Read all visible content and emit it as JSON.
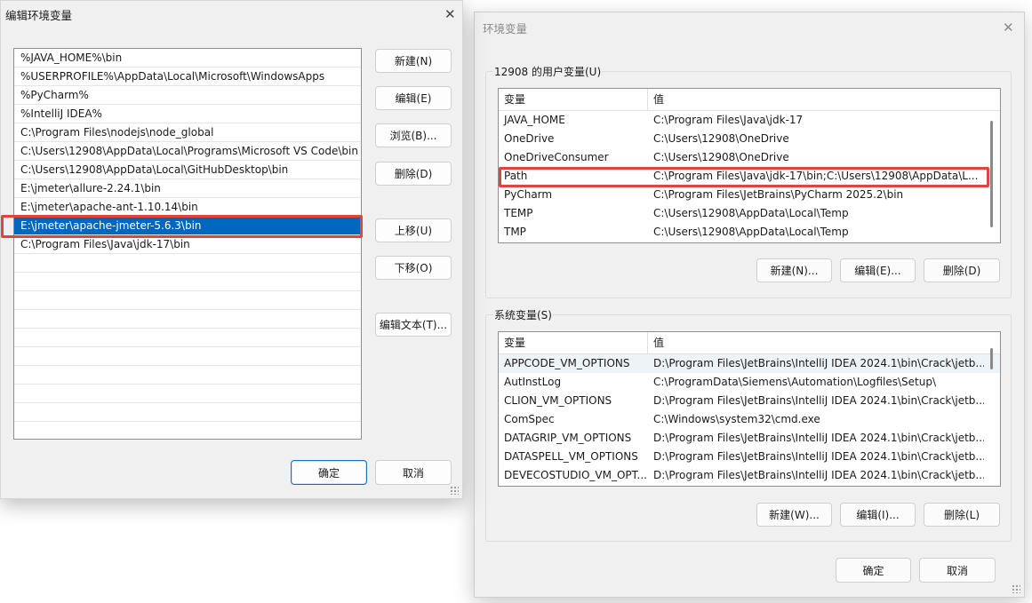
{
  "edit_dialog": {
    "title": "编辑环境变量",
    "paths": [
      "%JAVA_HOME%\\bin",
      "%USERPROFILE%\\AppData\\Local\\Microsoft\\WindowsApps",
      "%PyCharm%",
      "%IntelliJ IDEA%",
      "C:\\Program Files\\nodejs\\node_global",
      "C:\\Users\\12908\\AppData\\Local\\Programs\\Microsoft VS Code\\bin",
      "C:\\Users\\12908\\AppData\\Local\\GitHubDesktop\\bin",
      "E:\\jmeter\\allure-2.24.1\\bin",
      "E:\\jmeter\\apache-ant-1.10.14\\bin",
      "E:\\jmeter\\apache-jmeter-5.6.3\\bin",
      "C:\\Program Files\\Java\\jdk-17\\bin",
      "",
      "",
      "",
      "",
      "",
      "",
      "",
      "",
      "",
      ""
    ],
    "selected_index": 9,
    "buttons": {
      "new": "新建(N)",
      "edit": "编辑(E)",
      "browse": "浏览(B)...",
      "delete": "删除(D)",
      "move_up": "上移(U)",
      "move_down": "下移(O)",
      "edit_text": "编辑文本(T)...",
      "ok": "确定",
      "cancel": "取消"
    }
  },
  "env_dialog": {
    "title": "环境变量",
    "user_group": {
      "label": "12908 的用户变量(U)",
      "col_name": "变量",
      "col_value": "值",
      "rows": [
        {
          "name": "JAVA_HOME",
          "value": "C:\\Program Files\\Java\\jdk-17"
        },
        {
          "name": "OneDrive",
          "value": "C:\\Users\\12908\\OneDrive"
        },
        {
          "name": "OneDriveConsumer",
          "value": "C:\\Users\\12908\\OneDrive"
        },
        {
          "name": "Path",
          "value": "C:\\Program Files\\Java\\jdk-17\\bin;C:\\Users\\12908\\AppData\\L..."
        },
        {
          "name": "PyCharm",
          "value": "C:\\Program Files\\JetBrains\\PyCharm 2025.2\\bin"
        },
        {
          "name": "TEMP",
          "value": "C:\\Users\\12908\\AppData\\Local\\Temp"
        },
        {
          "name": "TMP",
          "value": "C:\\Users\\12908\\AppData\\Local\\Temp"
        }
      ],
      "buttons": {
        "new": "新建(N)...",
        "edit": "编辑(E)...",
        "delete": "删除(D)"
      }
    },
    "system_group": {
      "label": "系统变量(S)",
      "col_name": "变量",
      "col_value": "值",
      "rows": [
        {
          "name": "APPCODE_VM_OPTIONS",
          "value": "D:\\Program Files\\JetBrains\\IntelliJ IDEA 2024.1\\bin\\Crack\\jetb..."
        },
        {
          "name": "AutInstLog",
          "value": "C:\\ProgramData\\Siemens\\Automation\\Logfiles\\Setup\\"
        },
        {
          "name": "CLION_VM_OPTIONS",
          "value": "D:\\Program Files\\JetBrains\\IntelliJ IDEA 2024.1\\bin\\Crack\\jetb..."
        },
        {
          "name": "ComSpec",
          "value": "C:\\Windows\\system32\\cmd.exe"
        },
        {
          "name": "DATAGRIP_VM_OPTIONS",
          "value": "D:\\Program Files\\JetBrains\\IntelliJ IDEA 2024.1\\bin\\Crack\\jetb..."
        },
        {
          "name": "DATASPELL_VM_OPTIONS",
          "value": "D:\\Program Files\\JetBrains\\IntelliJ IDEA 2024.1\\bin\\Crack\\jetb..."
        },
        {
          "name": "DEVECOSTUDIO_VM_OPT...",
          "value": "D:\\Program Files\\JetBrains\\IntelliJ IDEA 2024.1\\bin\\Crack\\jetb..."
        }
      ],
      "buttons": {
        "new": "新建(W)...",
        "edit": "编辑(I)...",
        "delete": "删除(L)"
      }
    },
    "buttons": {
      "ok": "确定",
      "cancel": "取消"
    }
  }
}
